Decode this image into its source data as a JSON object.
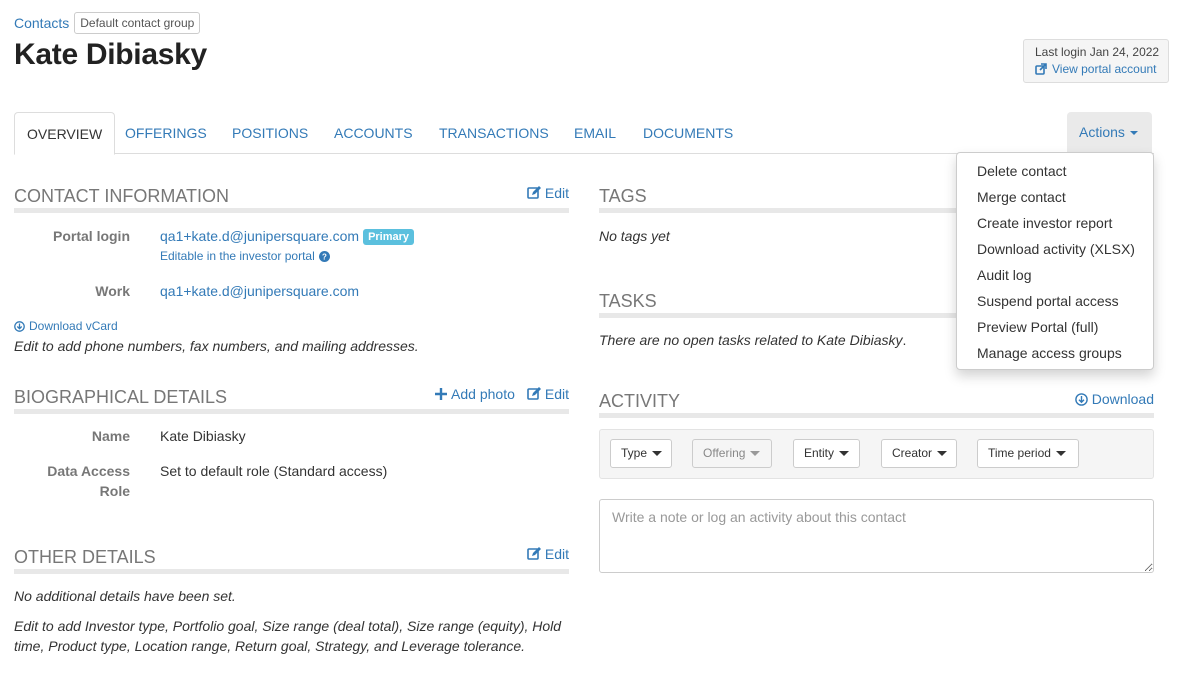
{
  "breadcrumb": {
    "root": "Contacts",
    "group": "Default contact group"
  },
  "title": "Kate Dibiasky",
  "login": {
    "last_login": "Last login Jan 24, 2022",
    "portal_link": "View portal account"
  },
  "tabs": [
    "OVERVIEW",
    "OFFERINGS",
    "POSITIONS",
    "ACCOUNTS",
    "TRANSACTIONS",
    "EMAIL",
    "DOCUMENTS"
  ],
  "actions": {
    "label": "Actions",
    "menu": [
      "Delete contact",
      "Merge contact",
      "Create investor report",
      "Download activity (XLSX)",
      "Audit log",
      "Suspend portal access",
      "Preview Portal (full)",
      "Manage access groups"
    ]
  },
  "contact_info": {
    "heading": "CONTACT INFORMATION",
    "edit": "Edit",
    "portal_login_label": "Portal login",
    "portal_login_email": "qa1+kate.d@junipersquare.com",
    "primary_badge": "Primary",
    "editable_note": "Editable in the investor portal",
    "work_label": "Work",
    "work_email": "qa1+kate.d@junipersquare.com",
    "vcard": "Download vCard",
    "hint": "Edit to add phone numbers, fax numbers, and mailing addresses."
  },
  "bio": {
    "heading": "BIOGRAPHICAL DETAILS",
    "add_photo": "Add photo",
    "edit": "Edit",
    "name_label": "Name",
    "name_value": "Kate Dibiasky",
    "access_label_1": "Data Access",
    "access_label_2": "Role",
    "access_value": "Set to default role (Standard access)"
  },
  "other": {
    "heading": "OTHER DETAILS",
    "edit": "Edit",
    "none": "No additional details have been set.",
    "hint_1": "Edit to add Investor type, Portfolio goal, Size range (deal total), Size range (equity), Hold",
    "hint_2": "time, Product type, Location range, Return goal, Strategy, and Leverage tolerance."
  },
  "tags": {
    "heading": "TAGS",
    "empty": "No tags yet"
  },
  "tasks": {
    "heading": "TASKS",
    "empty_prefix": "There are no open tasks related to ",
    "empty_name": "Kate Dibiasky",
    "empty_suffix": "."
  },
  "activity": {
    "heading": "ACTIVITY",
    "download": "Download",
    "filters": [
      "Type",
      "Offering",
      "Entity",
      "Creator",
      "Time period"
    ],
    "note_placeholder": "Write a note or log an activity about this contact"
  },
  "colors": {
    "link": "#337ab7",
    "badge": "#5bc0de",
    "heading": "#777777"
  }
}
